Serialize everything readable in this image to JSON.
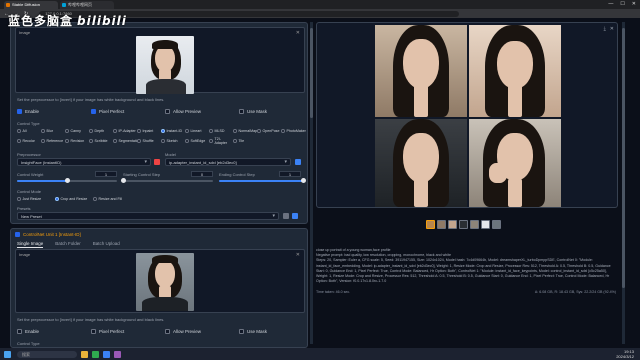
{
  "browser": {
    "tabs": [
      {
        "label": "Stable Diffusion"
      },
      {
        "label": "哔哩哔哩网页"
      }
    ],
    "url": "127.0.0.1:7860"
  },
  "overlay": {
    "brand_cn": "蓝色多脑盒",
    "brand_bili": "bilibili"
  },
  "left": {
    "unit0": {
      "image_label": "Image",
      "note": "Set the preprocessor to [invert] if your image has white background and black lines.",
      "checks": [
        "Enable",
        "Pixel Perfect",
        "Allow Preview",
        "Use Mask"
      ],
      "control_type_label": "Control Type",
      "control_types": [
        "All",
        "Blur",
        "Canny",
        "Depth",
        "IP-Adapter",
        "Inpaint",
        "Instant-ID",
        "Lineart",
        "MLSD",
        "NormalMap",
        "OpenPose",
        "PhotoMaker",
        "Recolor",
        "Reference",
        "Revision",
        "Scribble",
        "Segmentation",
        "Shuffle",
        "Sketch",
        "SoftEdge",
        "T2I-Adapter",
        "Tile"
      ],
      "control_type_selected": "Instant-ID",
      "preprocessor_label": "Preprocessor",
      "preprocessor_value": "InsightFace (InstantID)",
      "model_label": "Model",
      "model_value": "ip-adapter_instant_id_sdxl [eb2d3ec0]",
      "control_weight_label": "Control Weight",
      "control_weight_value": "1",
      "control_weight_fraction": 0.5,
      "start_label": "Starting Control Step",
      "start_value": "0",
      "start_fraction": 0,
      "end_label": "Ending Control Step",
      "end_value": "1",
      "end_fraction": 1,
      "control_mode_label": "Control Mode",
      "control_modes": [
        "Just Resize",
        "Crop and Resize",
        "Resize and Fill"
      ],
      "control_mode_selected": "Crop and Resize",
      "preset_label": "Presets",
      "preset_value": "New Preset"
    },
    "unit1": {
      "header": "ControlNet Unit 1 [Instant-ID]",
      "subtabs": [
        "Single Image",
        "Batch Folder",
        "Batch Upload"
      ],
      "image_label": "Image",
      "note": "Set the preprocessor to [invert] if your image has white background and black lines.",
      "checks": [
        "Enable",
        "Pixel Perfect",
        "Allow Preview",
        "Use Mask"
      ],
      "control_type_label": "Control Type"
    }
  },
  "right": {
    "info_text": "close up portrait of a young woman,face profile\nNegative prompt: bad quality, low resolution, cropping, monochrome, black and white\nSteps: 20, Sampler: Euler a, CFG scale: 5, Seed: 3911947155, Size: 1024x1024, Model hash: 7c4d09664b, Model: dreamshaperXL_turboDpmppSDE, ControlNet 0: \"Module: instant_id_face_embedding, Model: ip-adapter_instant_id_sdxl [eb2d3ec0], Weight: 1, Resize Mode: Crop and Resize, Processor Res: 512, Threshold A: 0.5, Threshold B: 0.5, Guidance Start: 0, Guidance End: 1, Pixel Perfect: True, Control Mode: Balanced, Hr Option: Both\", ControlNet 1: \"Module: instant_id_face_keypoints, Model: control_instant_id_sdxl [c5c25a50], Weight: 1, Resize Mode: Crop and Resize, Processor Res: 512, Threshold A: 0.5, Threshold B: 0.5, Guidance Start: 0, Guidance End: 1, Pixel Perfect: True, Control Mode: Balanced, Hr Option: Both\", Version: f0.0.17v1.8.0rc-1.7.0",
    "footer_left": "Time taken: 46.0 sec.",
    "footer_right": "A: 6.08 GB, R: 18.43 GB, Sys: 22.2/24 GB (92.4%)"
  },
  "taskbar": {
    "search": "搜索",
    "time": "19:13",
    "date": "2024/3/12"
  }
}
